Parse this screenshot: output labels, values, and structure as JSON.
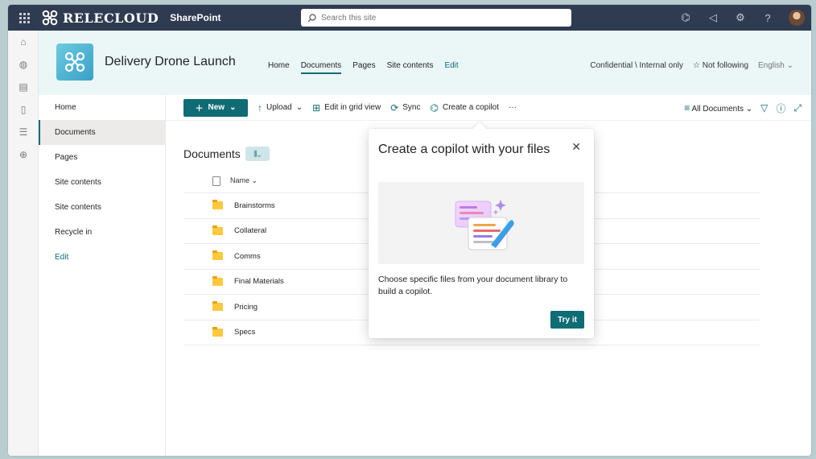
{
  "suitebar": {
    "brand_name": "RELECLOUD",
    "app_name": "SharePoint",
    "search_placeholder": "Search this site"
  },
  "header": {
    "site_title": "Delivery Drone Launch",
    "nav": [
      "Home",
      "Documents",
      "Pages",
      "Site contents",
      "Edit"
    ],
    "active_nav": "Documents",
    "classification": "Confidential \\ Internal only",
    "follow": "Not following",
    "language": "English"
  },
  "left_nav": {
    "items": [
      "Home",
      "Documents",
      "Pages",
      "Site contents",
      "Site contents",
      "Recycle in",
      "Edit"
    ],
    "active": "Documents"
  },
  "commandbar": {
    "new": "New",
    "upload": "Upload",
    "grid_view": "Edit in grid view",
    "sync": "Sync",
    "copilot": "Create a copilot",
    "more": "···",
    "view": "All Documents"
  },
  "library": {
    "title": "Documents",
    "column_name": "Name",
    "folders": [
      "Brainstorms",
      "Collateral",
      "Comms",
      "Final Materials",
      "Pricing",
      "Specs"
    ]
  },
  "popover": {
    "title": "Create a copilot with your files",
    "description": "Choose specific files from your document library to build a copilot.",
    "button": "Try it"
  },
  "colors": {
    "accent": "#0f6c74",
    "suitebar": "#2f3b51",
    "header_bg": "#ebf6f7"
  }
}
